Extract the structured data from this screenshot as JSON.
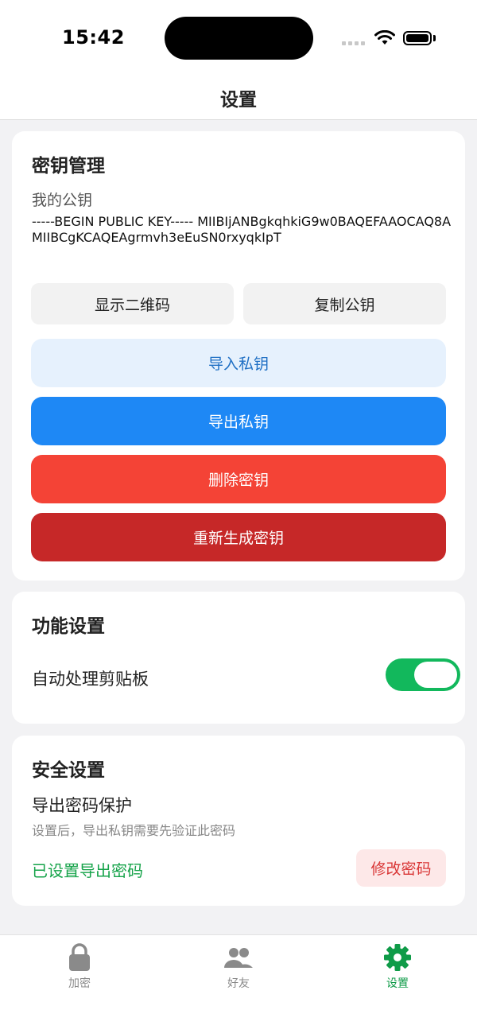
{
  "status_bar": {
    "time": "15:42"
  },
  "nav": {
    "title": "设置"
  },
  "key_management": {
    "title": "密钥管理",
    "my_public_key_label": "我的公钥",
    "public_key": "-----BEGIN PUBLIC KEY----- MIIBIjANBgkqhkiG9w0BAQEFAAOCAQ8AMIIBCgKCAQEAgrmvh3eEuSN0rxyqkIpT",
    "show_qr_label": "显示二维码",
    "copy_key_label": "复制公钥",
    "import_private_label": "导入私钥",
    "export_private_label": "导出私钥",
    "delete_key_label": "删除密钥",
    "regenerate_key_label": "重新生成密钥"
  },
  "function_settings": {
    "title": "功能设置",
    "auto_clipboard_label": "自动处理剪贴板",
    "auto_clipboard_enabled": true
  },
  "security_settings": {
    "title": "安全设置",
    "export_password_title": "导出密码保护",
    "export_password_desc": "设置后，导出私钥需要先验证此密码",
    "status_text": "已设置导出密码",
    "change_password_label": "修改密码"
  },
  "tab_bar": {
    "tabs": [
      {
        "label": "加密",
        "icon": "lock-icon"
      },
      {
        "label": "好友",
        "icon": "people-icon"
      },
      {
        "label": "设置",
        "icon": "gear-icon",
        "active": true
      }
    ],
    "active_color": "#0f9b48",
    "inactive_color": "#8a8a8a"
  },
  "colors": {
    "primary_blue": "#1e88f5",
    "danger_red": "#f44336",
    "dark_red": "#c62828",
    "toggle_green": "#12b85c"
  }
}
